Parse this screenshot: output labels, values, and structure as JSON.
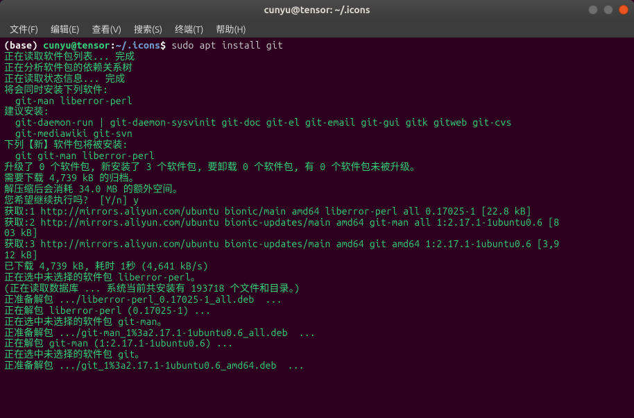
{
  "window": {
    "title": "cunyu@tensor: ~/.icons"
  },
  "menubar": {
    "file": "文件(F)",
    "edit": "编辑(E)",
    "view": "查看(V)",
    "search": "搜索(S)",
    "terminal": "终端(T)",
    "help": "帮助(H)"
  },
  "prompt": {
    "env": "(base) ",
    "userhost": "cunyu@tensor",
    "colon": ":",
    "path": "~/.icons",
    "dollar": "$ ",
    "command": "sudo apt install git"
  },
  "out": {
    "l1": "正在读取软件包列表... 完成",
    "l2": "正在分析软件包的依赖关系树       ",
    "l3": "正在读取状态信息... 完成       ",
    "l4": "将会同时安装下列软件:",
    "l5": "  git-man liberror-perl",
    "l6": "建议安装:",
    "l7": "  git-daemon-run | git-daemon-sysvinit git-doc git-el git-email git-gui gitk gitweb git-cvs",
    "l8": "  git-mediawiki git-svn",
    "l9": "下列【新】软件包将被安装:",
    "l10": "  git git-man liberror-perl",
    "l11": "升级了 0 个软件包, 新安装了 3 个软件包, 要卸载 0 个软件包, 有 0 个软件包未被升级。",
    "l12": "需要下载 4,739 kB 的归档。",
    "l13": "解压缩后会消耗 34.0 MB 的额外空间。",
    "l14": "您希望继续执行吗?  [Y/n] y",
    "l15": "获取:1 http://mirrors.aliyun.com/ubuntu bionic/main amd64 liberror-perl all 0.17025-1 [22.8 kB]",
    "l16": "获取:2 http://mirrors.aliyun.com/ubuntu bionic-updates/main amd64 git-man all 1:2.17.1-1ubuntu0.6 [8",
    "l17": "03 kB]",
    "l18": "获取:3 http://mirrors.aliyun.com/ubuntu bionic-updates/main amd64 git amd64 1:2.17.1-1ubuntu0.6 [3,9",
    "l19": "12 kB]",
    "l20": "已下载 4,739 kB, 耗时 1秒 (4,641 kB/s) ",
    "l21": "正在选中未选择的软件包 liberror-perl。",
    "l22": "(正在读取数据库 ... 系统当前共安装有 193718 个文件和目录。)",
    "l23": "正准备解包 .../liberror-perl_0.17025-1_all.deb  ...",
    "l24": "正在解包 liberror-perl (0.17025-1) ...",
    "l25": "正在选中未选择的软件包 git-man。",
    "l26": "正准备解包 .../git-man_1%3a2.17.1-1ubuntu0.6_all.deb  ...",
    "l27": "正在解包 git-man (1:2.17.1-1ubuntu0.6) ...",
    "l28": "正在选中未选择的软件包 git。",
    "l29": "正准备解包 .../git_1%3a2.17.1-1ubuntu0.6_amd64.deb  ..."
  }
}
